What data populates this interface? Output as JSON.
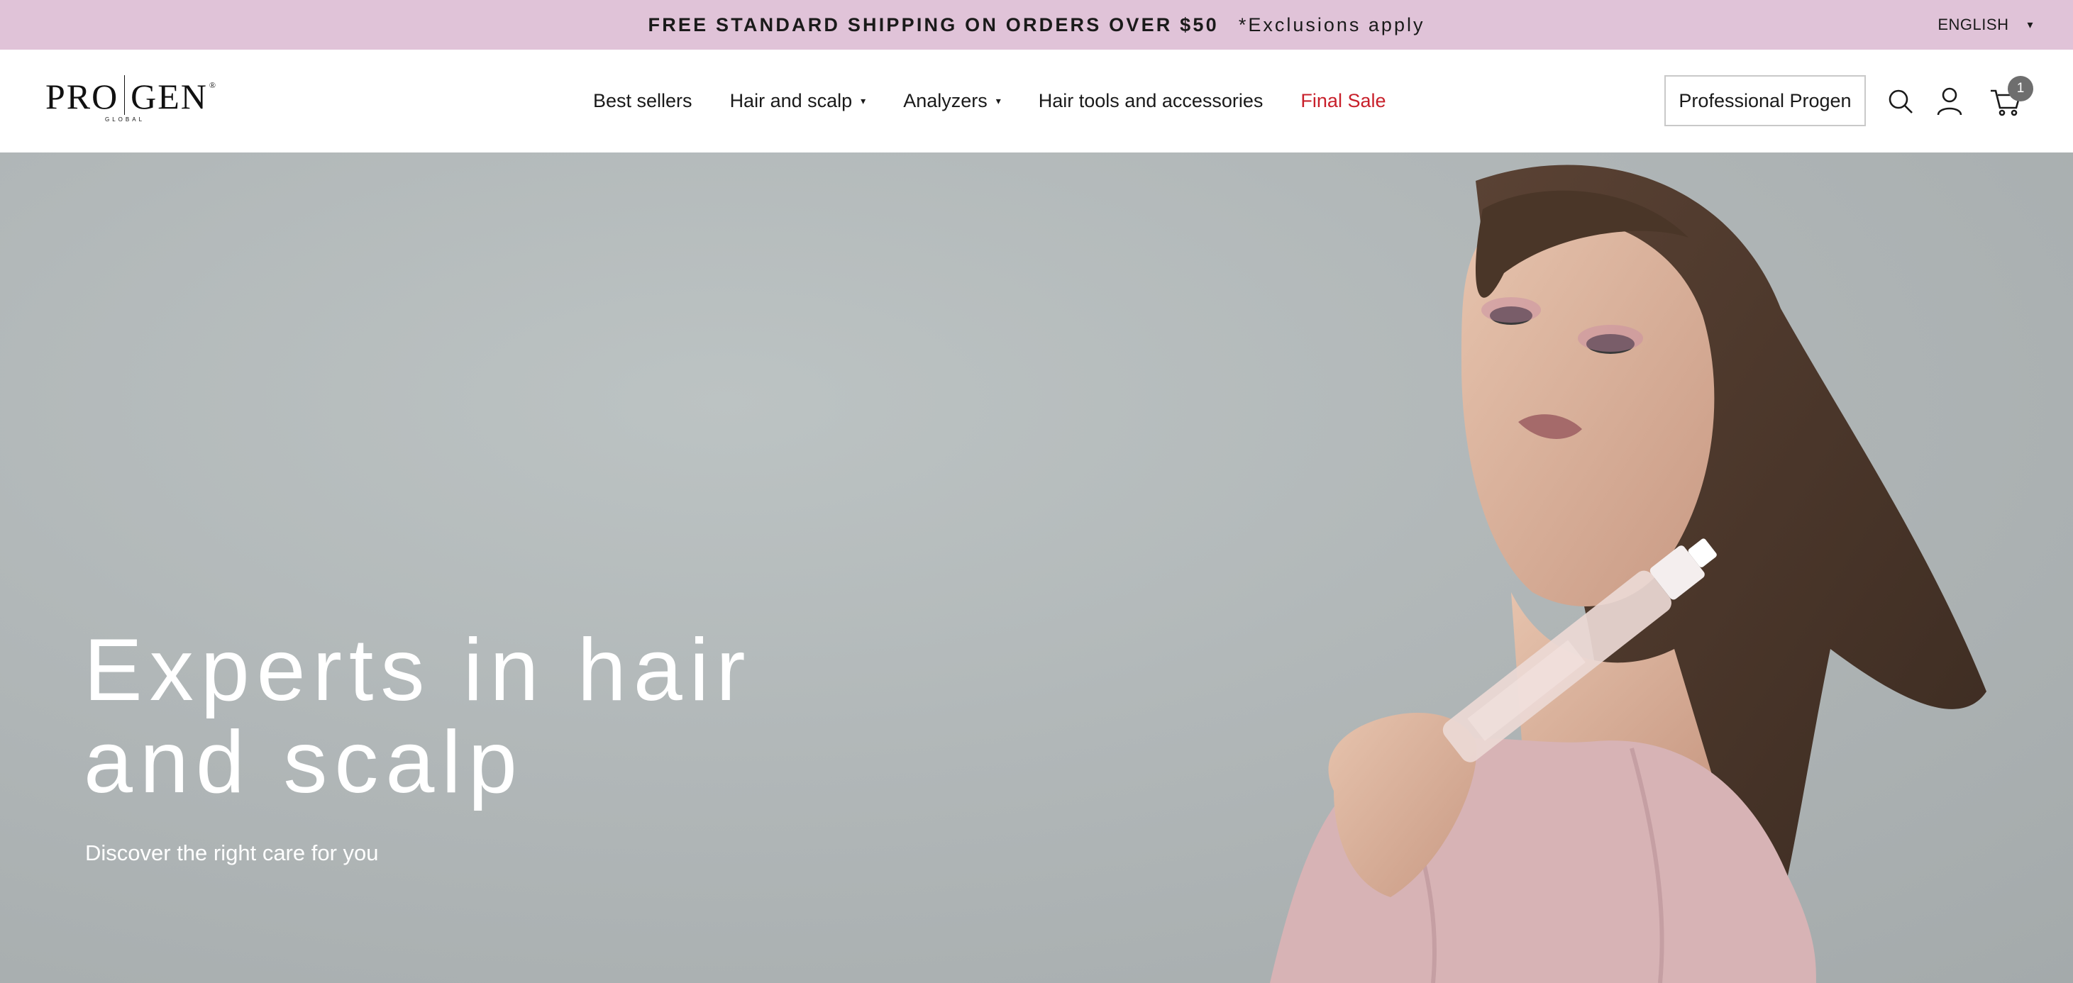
{
  "announcement": {
    "main": "FREE STANDARD SHIPPING ON ORDERS OVER $50",
    "note": "*Exclusions apply"
  },
  "language": {
    "selected": "ENGLISH",
    "caret": "▾"
  },
  "header": {
    "logo": {
      "word_left": "PRO",
      "word_right": "GEN",
      "reg": "®",
      "sub": "GLOBAL"
    },
    "nav": [
      {
        "label": "Best sellers",
        "has_dropdown": false
      },
      {
        "label": "Hair and scalp",
        "has_dropdown": true
      },
      {
        "label": "Analyzers",
        "has_dropdown": true
      },
      {
        "label": "Hair tools and accessories",
        "has_dropdown": false
      },
      {
        "label": "Final Sale",
        "has_dropdown": false
      }
    ],
    "caret": "▾",
    "professional_button": "Professional Progen",
    "icons": [
      "search-icon",
      "account-icon",
      "cart-icon"
    ],
    "cart_count": "1"
  },
  "hero": {
    "title_line1": "Experts in hair",
    "title_line2": "and scalp",
    "subtitle": "Discover the right care for you"
  },
  "colors": {
    "announcement_bg": "#e0c3d8",
    "sale_red": "#c8202b",
    "badge_gray": "#6e6e6e",
    "hero_bg": "#b1b7b8"
  }
}
